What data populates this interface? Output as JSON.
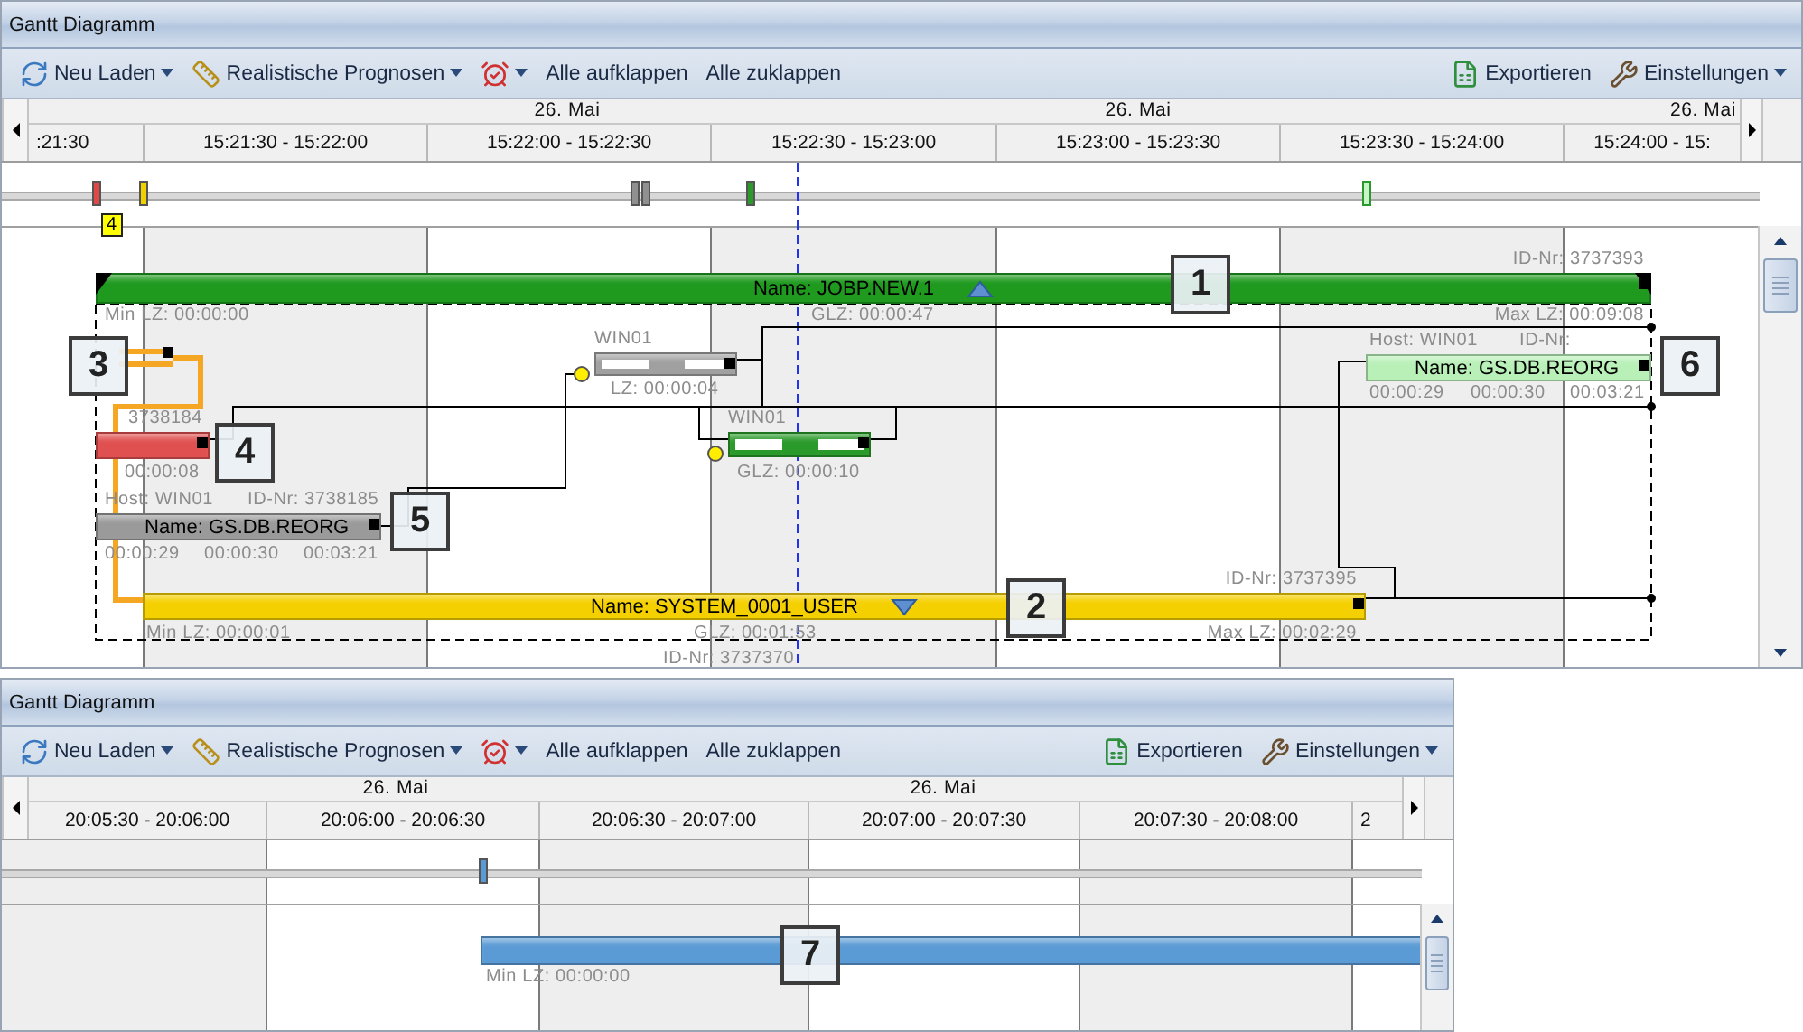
{
  "panels": [
    {
      "title": "Gantt Diagramm",
      "toolbar_left": [
        {
          "kind": "reload",
          "label": "Neu Laden",
          "dropdown": true
        },
        {
          "kind": "forecast",
          "label": "Realistische Prognosen",
          "dropdown": true
        },
        {
          "kind": "clock",
          "dropdown": true
        },
        {
          "kind": "text",
          "label": "Alle aufklappen",
          "dropdown": false
        },
        {
          "kind": "text",
          "label": "Alle zuklappen",
          "dropdown": false
        }
      ],
      "toolbar_right": [
        {
          "kind": "export",
          "label": "Exportieren",
          "dropdown": false
        },
        {
          "kind": "settings",
          "label": "Einstellungen",
          "dropdown": true
        }
      ],
      "dates": [
        "26. Mai",
        "26. Mai",
        "26. Mai"
      ],
      "slots": [
        ":21:30",
        "15:21:30 - 15:22:00",
        "15:22:00 - 15:22:30",
        "15:22:30 - 15:23:00",
        "15:23:00 - 15:23:30",
        "15:23:30 - 15:24:00",
        "15:24:00 - 15:"
      ],
      "markers": [
        {
          "color": "#e04848"
        },
        {
          "color": "#f0d000"
        },
        {
          "color": "#909090"
        },
        {
          "color": "#909090"
        },
        {
          "color": "#2a9a2a"
        },
        {
          "color": "#c8f5c8"
        }
      ],
      "overview_badge": "4",
      "bars": [
        {
          "kind": "summary",
          "color": "#1f9a1f",
          "name": "Name: JOBP.NEW.1",
          "expanded": true,
          "labels": [
            "ID-Nr: 3737393",
            "Min LZ: 00:00:00",
            "GLZ: 00:00:47",
            "Max LZ: 00:09:08"
          ]
        },
        {
          "kind": "link",
          "color": "#f5a623"
        },
        {
          "kind": "job",
          "color": "#e05050",
          "labels": [
            "3738184",
            "00:00:08"
          ]
        },
        {
          "kind": "job",
          "color": "#9a9a9a",
          "name": "Name: GS.DB.REORG",
          "labels": [
            "Host: WIN01",
            "ID-Nr: 3738185",
            "00:00:29",
            "00:00:30",
            "00:03:21"
          ]
        },
        {
          "kind": "summary",
          "color": "#f5d000",
          "name": "Name: SYSTEM_0001_USER",
          "expanded": false,
          "labels": [
            "ID-Nr: 3737395",
            "Min LZ: 00:00:01",
            "GLZ: 00:01:53",
            "Max LZ: 00:02:29",
            "ID-Nr: 3737370"
          ]
        },
        {
          "kind": "task",
          "color": "#a0a0a0",
          "labels": [
            "WIN01",
            "LZ: 00:00:04"
          ]
        },
        {
          "kind": "task",
          "color": "#2a9a2a",
          "labels": [
            "WIN01",
            "GLZ: 00:00:10"
          ]
        },
        {
          "kind": "job",
          "color": "#b8f0b8",
          "name": "Name: GS.DB.REORG",
          "labels": [
            "Host: WIN01",
            "ID-Nr:",
            "00:00:29",
            "00:00:30",
            "00:03:21"
          ]
        }
      ],
      "callouts": [
        "1",
        "2",
        "3",
        "4",
        "5",
        "6"
      ]
    },
    {
      "title": "Gantt Diagramm",
      "toolbar_left": [
        {
          "kind": "reload",
          "label": "Neu Laden",
          "dropdown": true
        },
        {
          "kind": "forecast",
          "label": "Realistische Prognosen",
          "dropdown": true
        },
        {
          "kind": "clock",
          "dropdown": true
        },
        {
          "kind": "text",
          "label": "Alle aufklappen",
          "dropdown": false
        },
        {
          "kind": "text",
          "label": "Alle zuklappen",
          "dropdown": false
        }
      ],
      "toolbar_right": [
        {
          "kind": "export",
          "label": "Exportieren",
          "dropdown": false
        },
        {
          "kind": "settings",
          "label": "Einstellungen",
          "dropdown": true
        }
      ],
      "dates": [
        "26. Mai",
        "26. Mai"
      ],
      "slots": [
        "20:05:30 - 20:06:00",
        "20:06:00 - 20:06:30",
        "20:06:30 - 20:07:00",
        "20:07:00 - 20:07:30",
        "20:07:30 - 20:08:00",
        "2"
      ],
      "markers": [
        {
          "color": "#5b9bd5"
        }
      ],
      "bars": [
        {
          "kind": "job",
          "color": "#5b9bd5",
          "labels": [
            "Min LZ: 00:00:00"
          ]
        }
      ],
      "callouts": [
        "7"
      ]
    }
  ]
}
